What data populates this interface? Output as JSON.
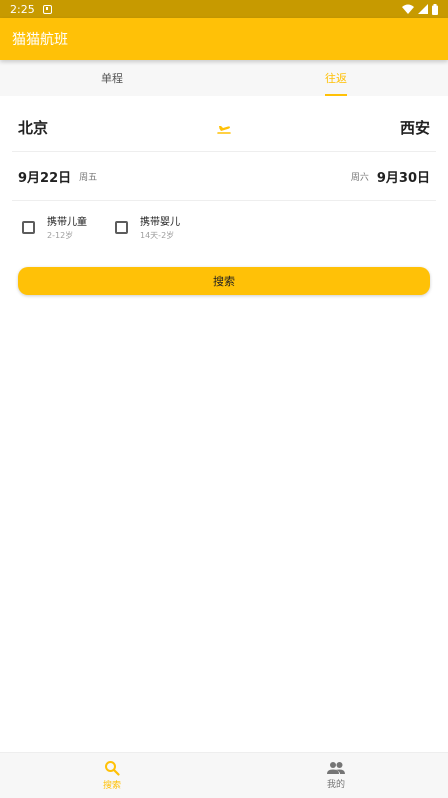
{
  "status_bar": {
    "time": "2:25"
  },
  "app_bar": {
    "title": "猫猫航班"
  },
  "tabs": [
    {
      "label": "单程",
      "active": false
    },
    {
      "label": "往返",
      "active": true
    }
  ],
  "route": {
    "from": "北京",
    "to": "西安",
    "swap_icon": "airplane-takeoff-icon"
  },
  "dates": {
    "depart": {
      "date": "9月22日",
      "weekday": "周五"
    },
    "return": {
      "date": "9月30日",
      "weekday": "周六"
    }
  },
  "options": [
    {
      "label": "携带儿童",
      "sub": "2-12岁",
      "checked": false
    },
    {
      "label": "携带婴儿",
      "sub": "14天-2岁",
      "checked": false
    }
  ],
  "search_button": {
    "label": "搜索"
  },
  "bottom_nav": [
    {
      "label": "搜索",
      "icon": "search-icon",
      "active": true
    },
    {
      "label": "我的",
      "icon": "people-icon",
      "active": false
    }
  ],
  "colors": {
    "accent": "#ffc107",
    "status_bar": "#c79a00"
  }
}
